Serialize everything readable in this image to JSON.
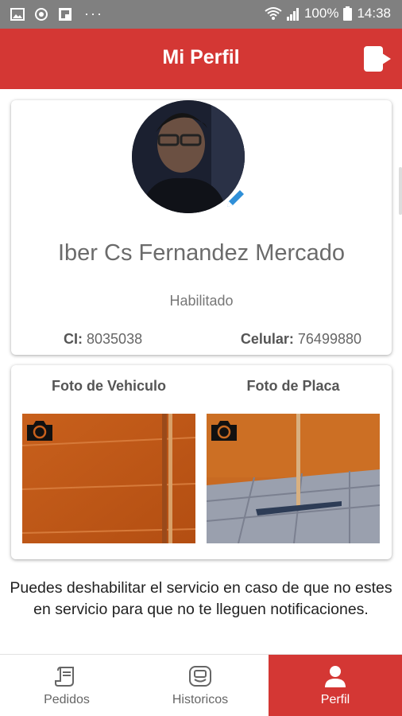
{
  "status_bar": {
    "battery": "100%",
    "time": "14:38"
  },
  "header": {
    "title": "Mi Perfil"
  },
  "profile": {
    "name": "Iber Cs Fernandez Mercado",
    "status": "Habilitado",
    "ci_label": "CI:",
    "ci_value": "8035038",
    "celular_label": "Celular:",
    "celular_value": "76499880"
  },
  "photos": {
    "vehicle_label": "Foto de Vehiculo",
    "plate_label": "Foto de Placa"
  },
  "notice": "Puedes deshabilitar el servicio en caso de que no estes en servicio para que no te lleguen notificaciones.",
  "bottom_nav": {
    "items": [
      {
        "label": "Pedidos",
        "icon": "receipt-icon",
        "active": false
      },
      {
        "label": "Historicos",
        "icon": "history-icon",
        "active": false
      },
      {
        "label": "Perfil",
        "icon": "person-icon",
        "active": true
      }
    ]
  },
  "colors": {
    "primary": "#d43734",
    "statusbar": "#808080"
  }
}
